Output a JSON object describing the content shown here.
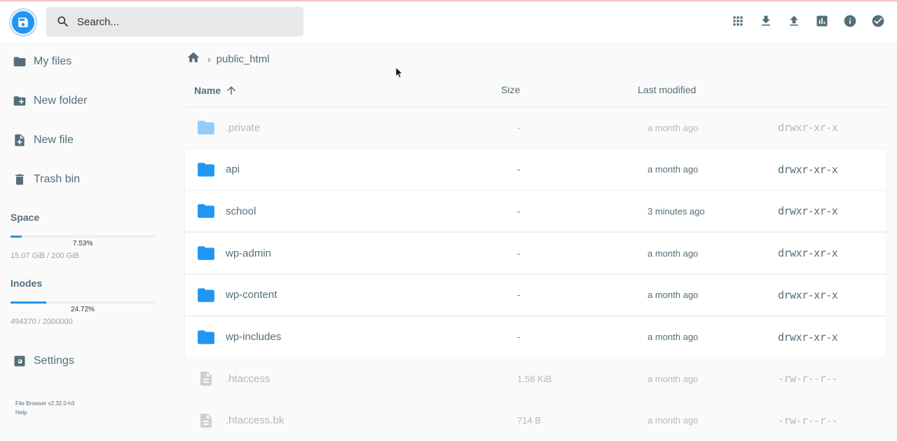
{
  "header": {
    "search_placeholder": "Search...",
    "actions": [
      "grid-view-icon",
      "download-icon",
      "upload-icon",
      "statistics-icon",
      "info-icon",
      "select-check-icon"
    ]
  },
  "sidebar": {
    "items": [
      {
        "label": "My files",
        "icon": "folder-icon"
      },
      {
        "label": "New folder",
        "icon": "create-new-folder-icon"
      },
      {
        "label": "New file",
        "icon": "note-add-icon"
      },
      {
        "label": "Trash bin",
        "icon": "trash-icon"
      }
    ],
    "space": {
      "title": "Space",
      "percent_label": "7.53%",
      "fraction": 0.0753,
      "value": "15.07 GiB / 200 GiB"
    },
    "inodes": {
      "title": "Inodes",
      "percent_label": "24.72%",
      "fraction": 0.2472,
      "value": "494370 / 2000000"
    },
    "settings_label": "Settings",
    "footer": {
      "version": "File Browser v2.32.0-h3",
      "help": "Help"
    }
  },
  "breadcrumb": {
    "current": "public_html"
  },
  "columns": {
    "name": "Name",
    "size": "Size",
    "modified": "Last modified"
  },
  "files": [
    {
      "name": ".private",
      "size": "-",
      "modified": "a month ago",
      "perm": "drwxr-xr-x",
      "type": "folder",
      "hidden": true
    },
    {
      "name": "api",
      "size": "-",
      "modified": "a month ago",
      "perm": "drwxr-xr-x",
      "type": "folder",
      "hidden": false
    },
    {
      "name": "school",
      "size": "-",
      "modified": "3 minutes ago",
      "perm": "drwxr-xr-x",
      "type": "folder",
      "hidden": false
    },
    {
      "name": "wp-admin",
      "size": "-",
      "modified": "a month ago",
      "perm": "drwxr-xr-x",
      "type": "folder",
      "hidden": false
    },
    {
      "name": "wp-content",
      "size": "-",
      "modified": "a month ago",
      "perm": "drwxr-xr-x",
      "type": "folder",
      "hidden": false
    },
    {
      "name": "wp-includes",
      "size": "-",
      "modified": "a month ago",
      "perm": "drwxr-xr-x",
      "type": "folder",
      "hidden": false
    },
    {
      "name": ".htaccess",
      "size": "1.58 KiB",
      "modified": "a month ago",
      "perm": "-rw-r--r--",
      "type": "file",
      "hidden": true
    },
    {
      "name": ".htaccess.bk",
      "size": "714 B",
      "modified": "a month ago",
      "perm": "-rw-r--r--",
      "type": "file",
      "hidden": true
    }
  ],
  "colors": {
    "accent": "#2196f3",
    "folder": "#2196f3",
    "text": "#546e7a"
  }
}
